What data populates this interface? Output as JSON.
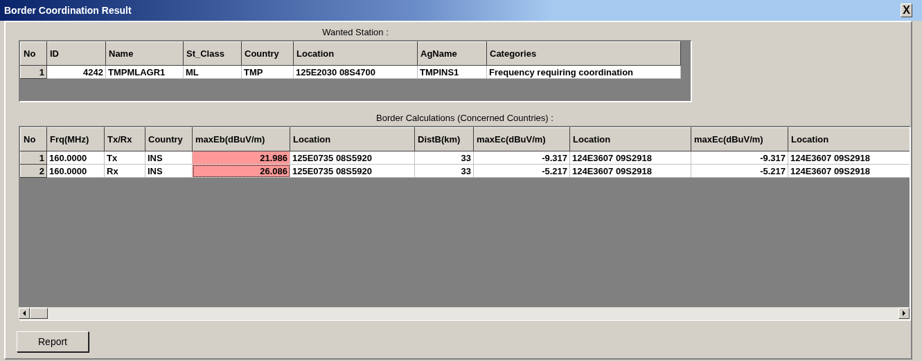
{
  "window": {
    "title": "Border Coordination Result",
    "close_button": "X"
  },
  "wanted_station": {
    "label": "Wanted Station :",
    "columns": [
      "No",
      "ID",
      "Name",
      "St_Class",
      "Country",
      "Location",
      "AgName",
      "Categories"
    ],
    "rows": [
      {
        "cells": [
          "1",
          "4242",
          "TMPMLAGR1",
          "ML",
          "TMP",
          "125E2030  08S4700",
          "TMPINS1",
          "Frequency requiring coordination"
        ]
      }
    ]
  },
  "border_calculations": {
    "label": "Border Calculations (Concerned Countries) :",
    "columns": [
      "No",
      "Frq(MHz)",
      "Tx/Rx",
      "Country",
      "maxEb(dBuV/m)",
      "Location",
      "DistB(km)",
      "maxEc(dBuV/m)",
      "Location",
      "maxEc(dBuV/m)",
      "Location"
    ],
    "rows": [
      {
        "cells": [
          "1",
          "160.0000",
          "Tx",
          "INS",
          "21.986",
          "125E0735  08S5920",
          "33",
          "-9.317",
          "124E3607  09S2918",
          "-9.317",
          "124E3607  09S2918"
        ],
        "exceeded": true,
        "focused": false
      },
      {
        "cells": [
          "2",
          "160.0000",
          "Rx",
          "INS",
          "26.086",
          "125E0735  08S5920",
          "33",
          "-5.217",
          "124E3607  09S2918",
          "-5.217",
          "124E3607  09S2918"
        ],
        "exceeded": true,
        "focused": true
      }
    ]
  },
  "buttons": [
    "Report"
  ]
}
